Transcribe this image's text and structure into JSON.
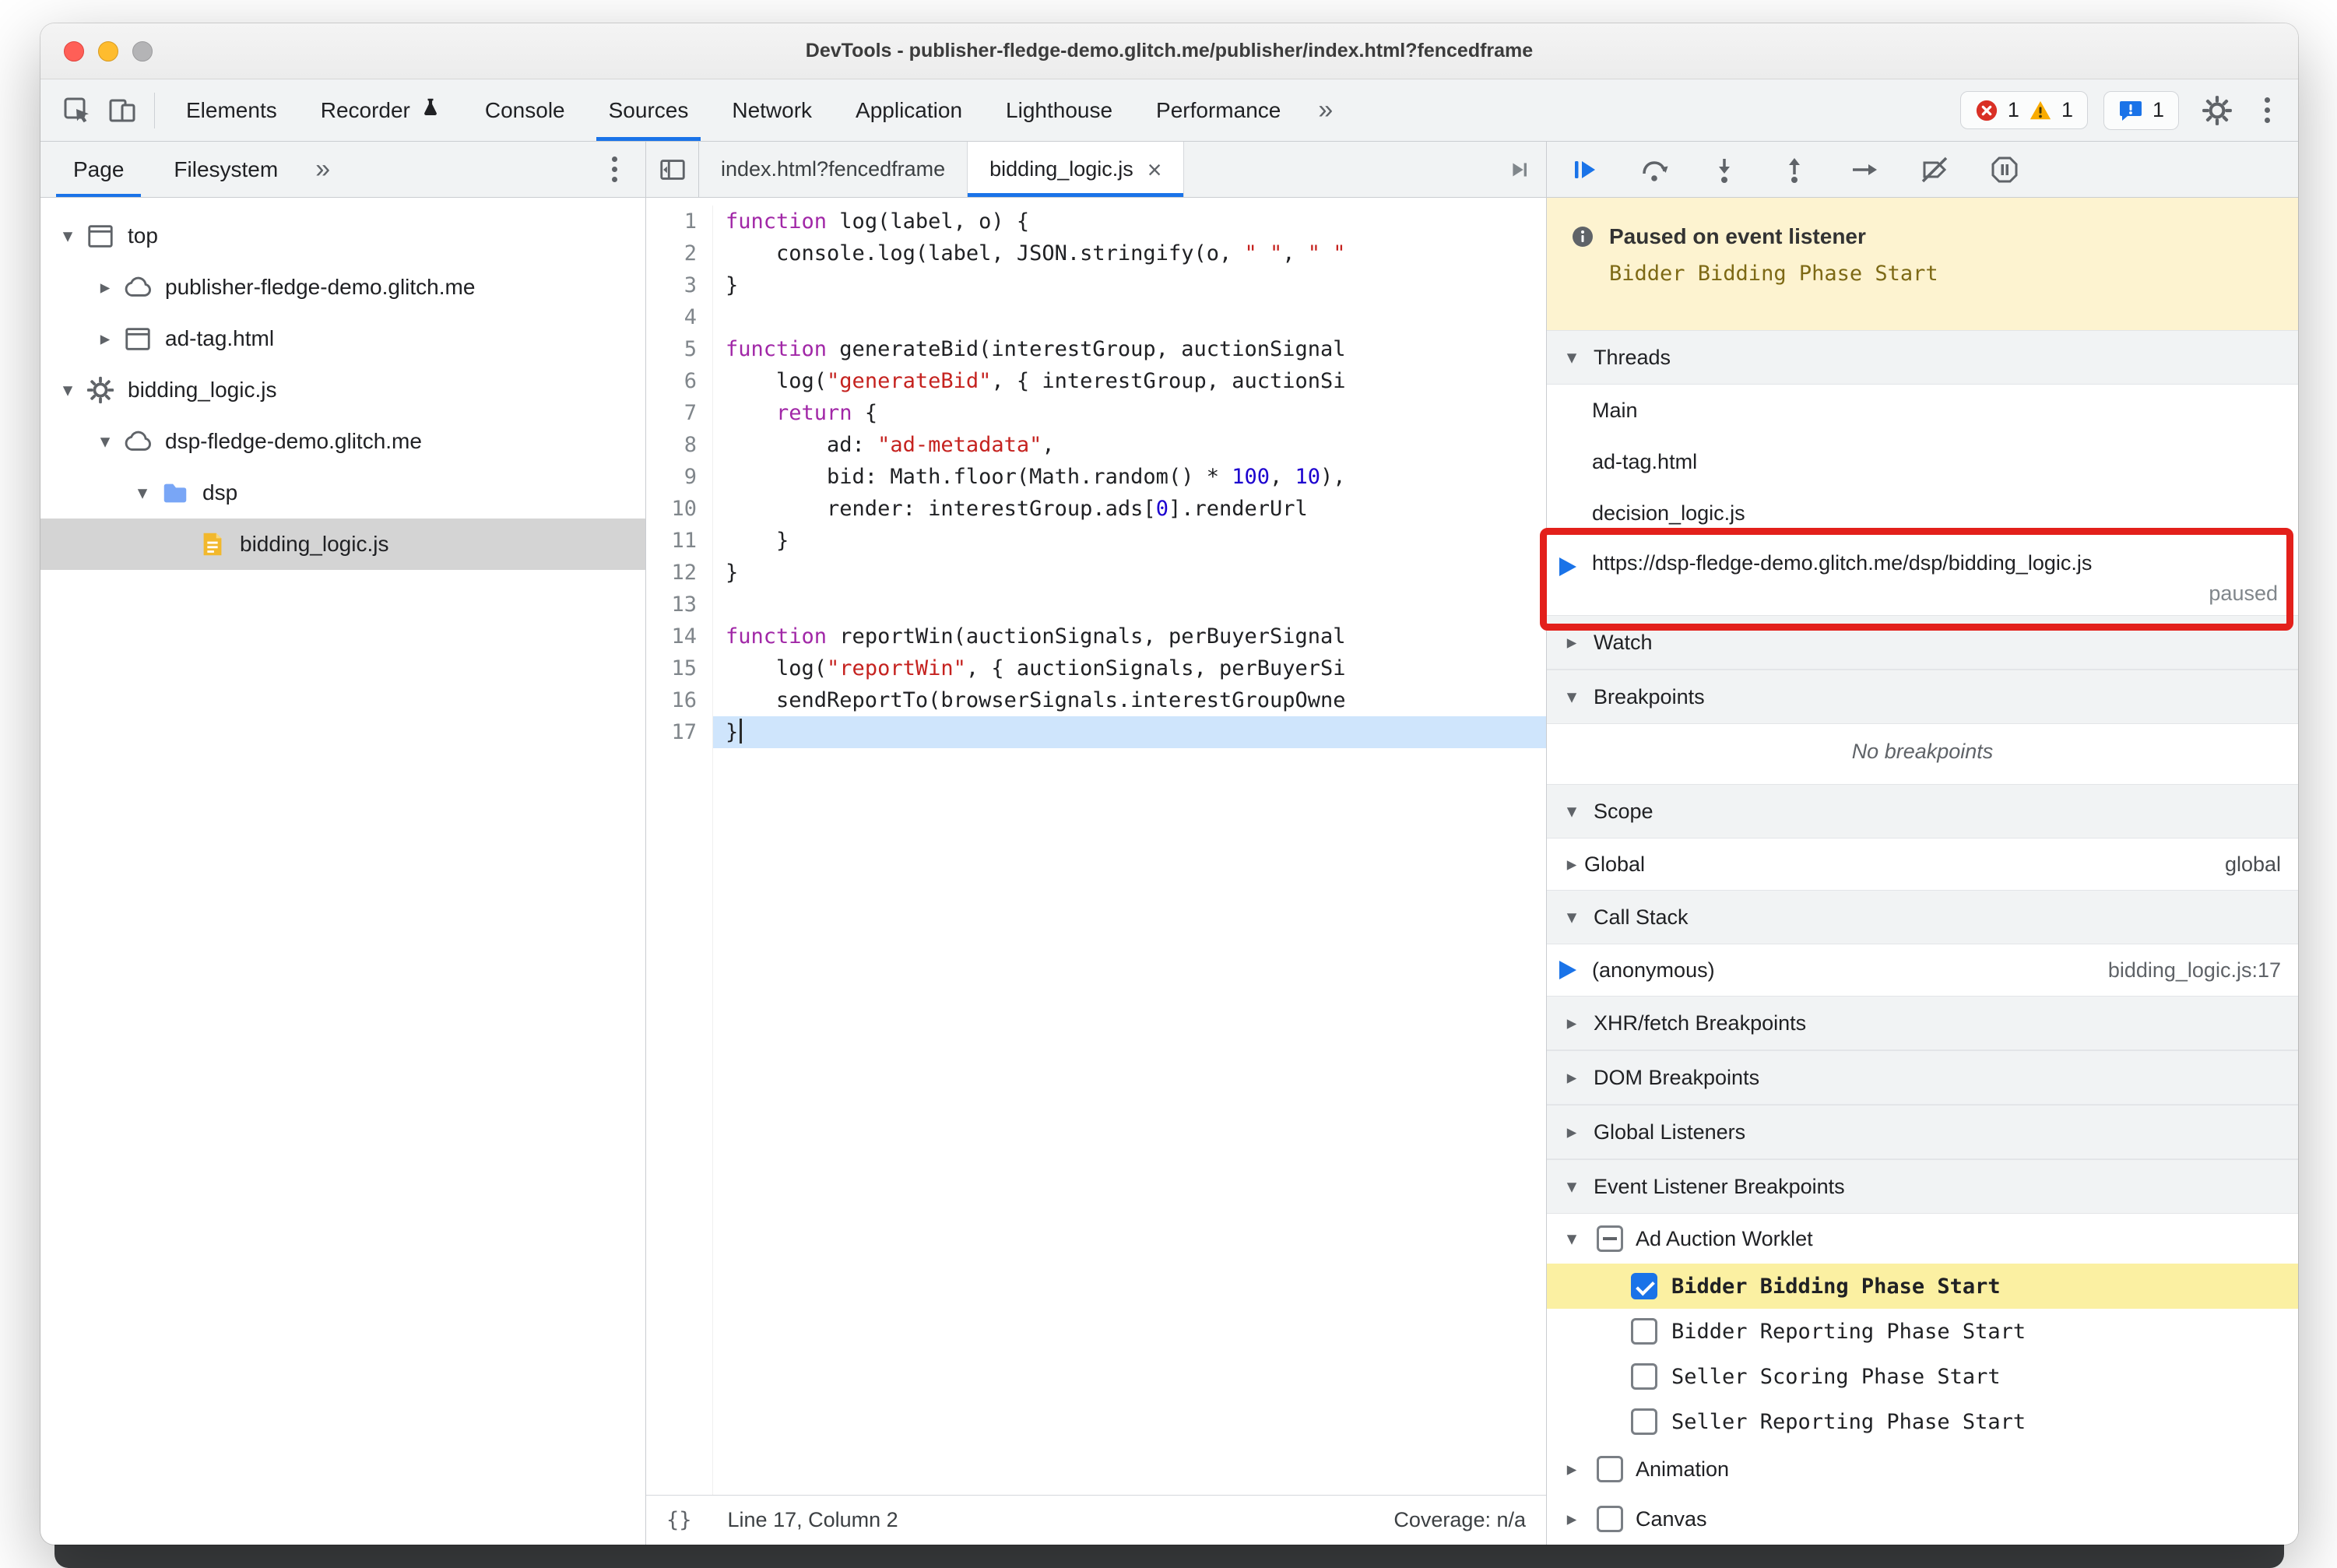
{
  "window": {
    "title": "DevTools - publisher-fledge-demo.glitch.me/publisher/index.html?fencedframe"
  },
  "toolbar": {
    "tabs": [
      {
        "label": "Elements"
      },
      {
        "label": "Recorder",
        "badge": "beaker"
      },
      {
        "label": "Console"
      },
      {
        "label": "Sources",
        "active": true
      },
      {
        "label": "Network"
      },
      {
        "label": "Application"
      },
      {
        "label": "Lighthouse"
      },
      {
        "label": "Performance"
      }
    ],
    "more_label": "»",
    "error_count": "1",
    "warning_count": "1",
    "issues_count": "1"
  },
  "navigator": {
    "tabs": [
      {
        "label": "Page",
        "active": true
      },
      {
        "label": "Filesystem"
      }
    ],
    "more_label": "»",
    "tree": [
      {
        "label": "top",
        "icon": "frame",
        "depth": 0,
        "expander": "open"
      },
      {
        "label": "publisher-fledge-demo.glitch.me",
        "icon": "cloud",
        "depth": 1,
        "expander": "closed"
      },
      {
        "label": "ad-tag.html",
        "icon": "frame",
        "depth": 1,
        "expander": "closed"
      },
      {
        "label": "bidding_logic.js",
        "icon": "gear",
        "depth": 0,
        "expander": "open"
      },
      {
        "label": "dsp-fledge-demo.glitch.me",
        "icon": "cloud",
        "depth": 1,
        "expander": "open"
      },
      {
        "label": "dsp",
        "icon": "folder",
        "depth": 2,
        "expander": "open"
      },
      {
        "label": "bidding_logic.js",
        "icon": "file",
        "depth": 3,
        "expander": "none",
        "selected": true
      }
    ]
  },
  "editor": {
    "tabs": [
      {
        "label": "index.html?fencedframe"
      },
      {
        "label": "bidding_logic.js",
        "active": true,
        "closable": true
      }
    ],
    "exec_line": 17,
    "lines": [
      {
        "n": 1,
        "tokens": [
          {
            "t": "function",
            "c": "kw"
          },
          {
            "t": " log(label, o) {"
          }
        ]
      },
      {
        "n": 2,
        "tokens": [
          {
            "t": "    console.log(label, JSON.stringify(o, "
          },
          {
            "t": "\" \"",
            "c": "str"
          },
          {
            "t": ", "
          },
          {
            "t": "\" \"",
            "c": "str"
          }
        ]
      },
      {
        "n": 3,
        "tokens": [
          {
            "t": "}"
          }
        ]
      },
      {
        "n": 4,
        "tokens": []
      },
      {
        "n": 5,
        "tokens": [
          {
            "t": "function",
            "c": "kw"
          },
          {
            "t": " generateBid(interestGroup, auctionSignal"
          }
        ]
      },
      {
        "n": 6,
        "tokens": [
          {
            "t": "    log("
          },
          {
            "t": "\"generateBid\"",
            "c": "str"
          },
          {
            "t": ", { interestGroup, auctionSi"
          }
        ]
      },
      {
        "n": 7,
        "tokens": [
          {
            "t": "    "
          },
          {
            "t": "return",
            "c": "kw"
          },
          {
            "t": " {"
          }
        ]
      },
      {
        "n": 8,
        "tokens": [
          {
            "t": "        ad: "
          },
          {
            "t": "\"ad-metadata\"",
            "c": "str"
          },
          {
            "t": ","
          }
        ]
      },
      {
        "n": 9,
        "tokens": [
          {
            "t": "        bid: Math.floor(Math.random() * "
          },
          {
            "t": "100",
            "c": "num"
          },
          {
            "t": ", "
          },
          {
            "t": "10",
            "c": "num"
          },
          {
            "t": "),"
          }
        ]
      },
      {
        "n": 10,
        "tokens": [
          {
            "t": "        render: interestGroup.ads["
          },
          {
            "t": "0",
            "c": "num"
          },
          {
            "t": "].renderUrl"
          }
        ]
      },
      {
        "n": 11,
        "tokens": [
          {
            "t": "    }"
          }
        ]
      },
      {
        "n": 12,
        "tokens": [
          {
            "t": "}"
          }
        ]
      },
      {
        "n": 13,
        "tokens": []
      },
      {
        "n": 14,
        "tokens": [
          {
            "t": "function",
            "c": "kw"
          },
          {
            "t": " reportWin(auctionSignals, perBuyerSignal"
          }
        ]
      },
      {
        "n": 15,
        "tokens": [
          {
            "t": "    log("
          },
          {
            "t": "\"reportWin\"",
            "c": "str"
          },
          {
            "t": ", { auctionSignals, perBuyerSi"
          }
        ]
      },
      {
        "n": 16,
        "tokens": [
          {
            "t": "    sendReportTo(browserSignals.interestGroupOwne"
          }
        ]
      },
      {
        "n": 17,
        "tokens": [
          {
            "t": "}"
          }
        ]
      }
    ],
    "status": {
      "line_col": "Line 17, Column 2",
      "coverage": "Coverage: n/a"
    }
  },
  "debugger": {
    "banner": {
      "title": "Paused on event listener",
      "subtitle": "Bidder Bidding Phase Start"
    },
    "threads": {
      "title": "Threads",
      "expanded": true,
      "items": [
        {
          "label": "Main"
        },
        {
          "label": "ad-tag.html"
        },
        {
          "label": "decision_logic.js"
        },
        {
          "label": "https://dsp-fledge-demo.glitch.me/dsp/bidding_logic.js",
          "status": "paused",
          "current": true
        }
      ]
    },
    "watch": {
      "title": "Watch",
      "expanded": false
    },
    "breakpoints": {
      "title": "Breakpoints",
      "expanded": true,
      "empty_message": "No breakpoints"
    },
    "scope": {
      "title": "Scope",
      "expanded": true,
      "rows": [
        {
          "label": "Global",
          "value": "global"
        }
      ]
    },
    "call_stack": {
      "title": "Call Stack",
      "expanded": true,
      "rows": [
        {
          "label": "(anonymous)",
          "location": "bidding_logic.js:17",
          "current": true
        }
      ]
    },
    "xhr_breakpoints": {
      "title": "XHR/fetch Breakpoints",
      "expanded": false
    },
    "dom_breakpoints": {
      "title": "DOM Breakpoints",
      "expanded": false
    },
    "global_listeners": {
      "title": "Global Listeners",
      "expanded": false
    },
    "event_listener_breakpoints": {
      "title": "Event Listener Breakpoints",
      "expanded": true,
      "categories": [
        {
          "label": "Ad Auction Worklet",
          "checkbox": "indeterminate",
          "expanded": true,
          "children": [
            {
              "label": "Bidder Bidding Phase Start",
              "checked": true,
              "highlighted": true
            },
            {
              "label": "Bidder Reporting Phase Start",
              "checked": false
            },
            {
              "label": "Seller Scoring Phase Start",
              "checked": false
            },
            {
              "label": "Seller Reporting Phase Start",
              "checked": false
            }
          ]
        },
        {
          "label": "Animation",
          "checkbox": "unchecked",
          "expanded": false
        },
        {
          "label": "Canvas",
          "checkbox": "unchecked",
          "expanded": false
        }
      ]
    }
  }
}
